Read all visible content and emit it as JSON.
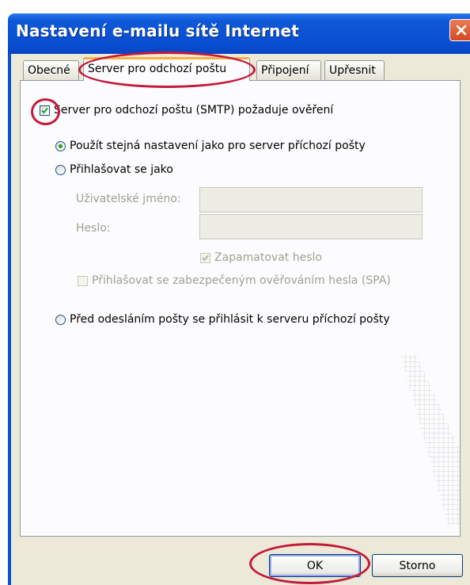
{
  "window": {
    "title": "Nastavení e-mailu sítě Internet",
    "close_icon": "close-icon"
  },
  "tabs": [
    {
      "label": "Obecné",
      "active": false
    },
    {
      "label": "Server pro odchozí poštu",
      "active": true
    },
    {
      "label": "Připojení",
      "active": false
    },
    {
      "label": "Upřesnit",
      "active": false
    }
  ],
  "smtp": {
    "requires_auth_label": "Server pro odchozí poštu (SMTP) požaduje ověření",
    "requires_auth_checked": true,
    "options": [
      {
        "label": "Použít stejná nastavení jako pro server příchozí pošty",
        "selected": true
      },
      {
        "label": "Přihlašovat se jako",
        "selected": false
      }
    ],
    "username_label": "Uživatelské jméno:",
    "username_value": "",
    "password_label": "Heslo:",
    "password_value": "",
    "remember_password_label": "Zapamatovat heslo",
    "remember_password_checked": true,
    "spa_label": "Přihlašovat se zabezpečeným ověřováním hesla (SPA)",
    "spa_checked": false,
    "login_before_send_label": "Před odesláním pošty se přihlásit k serveru příchozí pošty",
    "login_before_send_selected": false
  },
  "buttons": {
    "ok_label": "OK",
    "cancel_label": "Storno"
  },
  "colors": {
    "titlebar": "#0a4fd2",
    "dialog_bg": "#ece9d8",
    "panel_bg": "#fcfcfe",
    "highlight": "#c41a3a",
    "radio_dot": "#21a121"
  }
}
